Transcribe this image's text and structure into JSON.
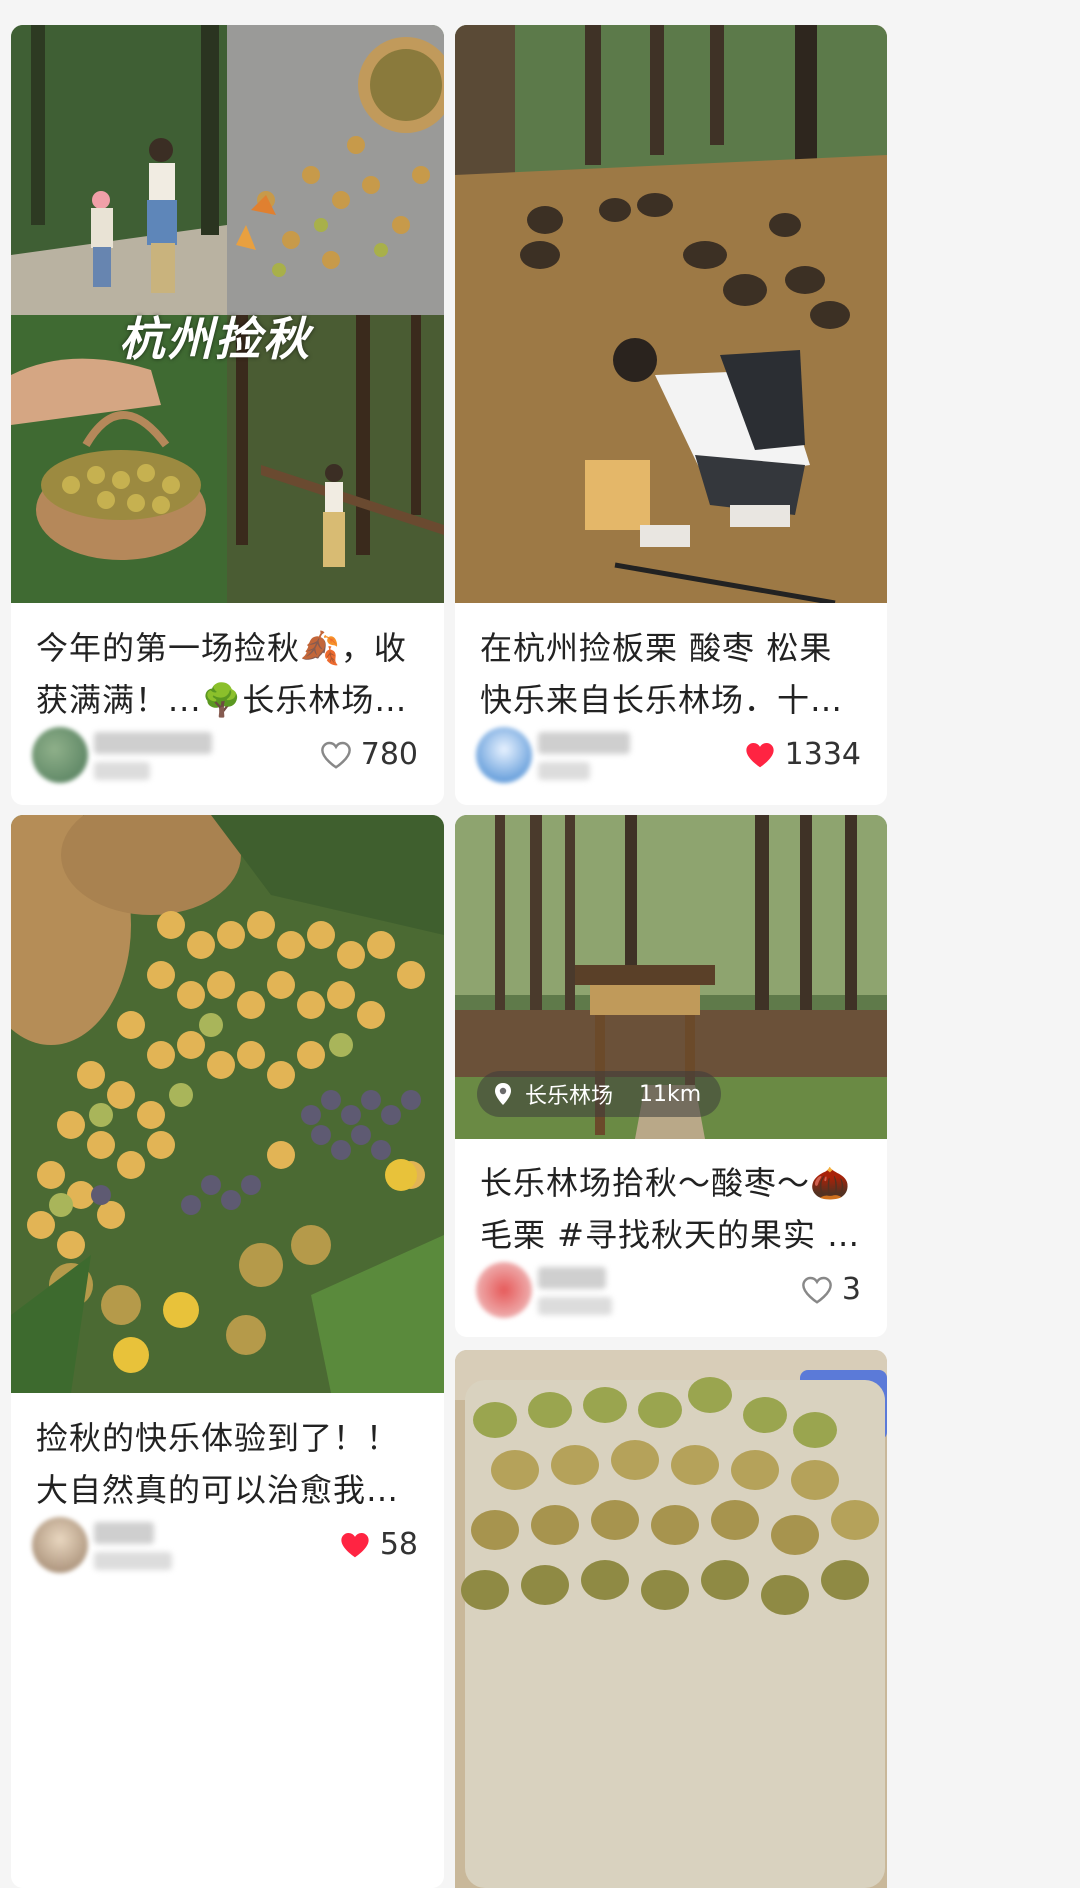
{
  "cards": [
    {
      "title": "今年的第一场捡秋🍂，收获满满！...🌳长乐林场🌳的南酸...",
      "overlay_text": "杭州捡秋",
      "likes": "780",
      "liked": false
    },
    {
      "title": "在杭州捡板栗 酸枣 松果 快乐来自长乐林场．十一假期🍂 捡...",
      "likes": "1334",
      "liked": true
    },
    {
      "title": "捡秋的快乐体验到了！！ 大自然真的可以治愈我～ 在小红书...",
      "likes": "58",
      "liked": true
    },
    {
      "title": "长乐林场拾秋～酸枣～🌰毛栗 #寻找秋天的果实 #长乐林场...",
      "location": "长乐林场",
      "distance": "11km",
      "likes": "3",
      "liked": false
    }
  ],
  "colors": {
    "liked": "#ff2442",
    "outline": "#888888"
  }
}
